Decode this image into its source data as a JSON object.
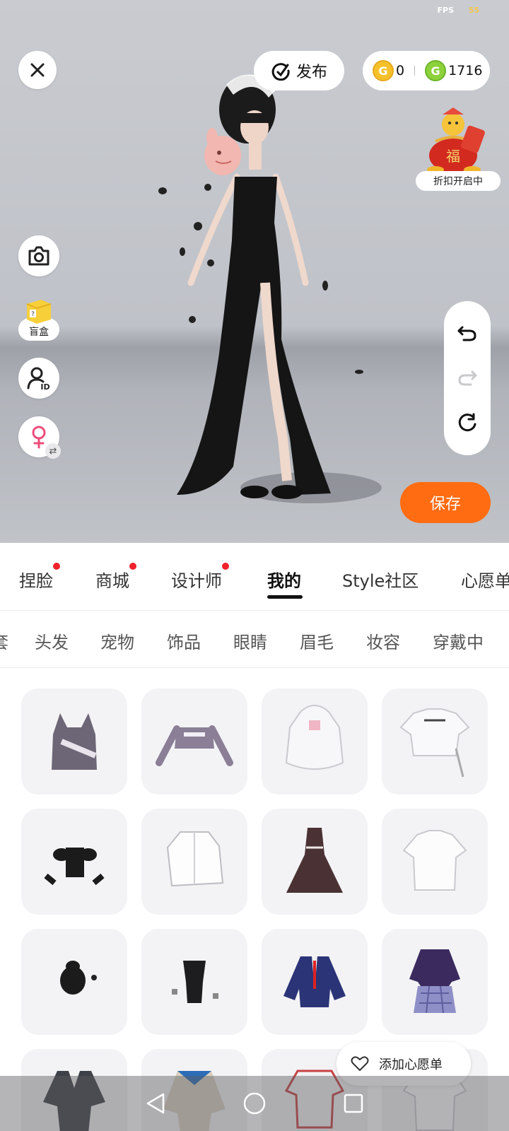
{
  "status_bar": {
    "fps_label": "FPS",
    "fps_value": "55"
  },
  "top_bar": {
    "publish_label": "发布",
    "currency": [
      {
        "name": "gold-coin",
        "icon": "G",
        "value": "0",
        "color": "#f5c12b"
      },
      {
        "name": "green-coin",
        "icon": "G",
        "value": "1716",
        "color": "#8dd13b"
      }
    ]
  },
  "promo": {
    "label": "折扣开启中",
    "badge_char": "福"
  },
  "left_tools": {
    "blind_box_label": "盲盒"
  },
  "actions": {
    "save_label": "保存"
  },
  "main_tabs": [
    {
      "label": "捏脸",
      "dot": true
    },
    {
      "label": "商城",
      "dot": true
    },
    {
      "label": "设计师",
      "dot": true
    },
    {
      "label": "我的",
      "dot": false,
      "active": true
    },
    {
      "label": "Style社区",
      "dot": false
    },
    {
      "label": "心愿单",
      "dot": false
    }
  ],
  "sub_tabs": [
    "套",
    "头发",
    "宠物",
    "饰品",
    "眼睛",
    "眉毛",
    "妆容",
    "穿戴中"
  ],
  "items": [
    "lace-camisole",
    "lace-crop-top",
    "white-hoodie",
    "white-drawstring-tee",
    "black-corset-set",
    "white-shirt",
    "brown-halter-dress",
    "white-tee",
    "black-hair-bun",
    "black-swimsuit",
    "navy-school-blazer",
    "purple-plaid-uniform",
    "grey-school-uniform",
    "beige-sailor-jacket",
    "red-outline-shirt",
    "white-bow-blouse"
  ],
  "wishlist": {
    "label": "添加心愿单"
  },
  "colors": {
    "accent": "#ff6c12",
    "dot": "#f0222b"
  }
}
